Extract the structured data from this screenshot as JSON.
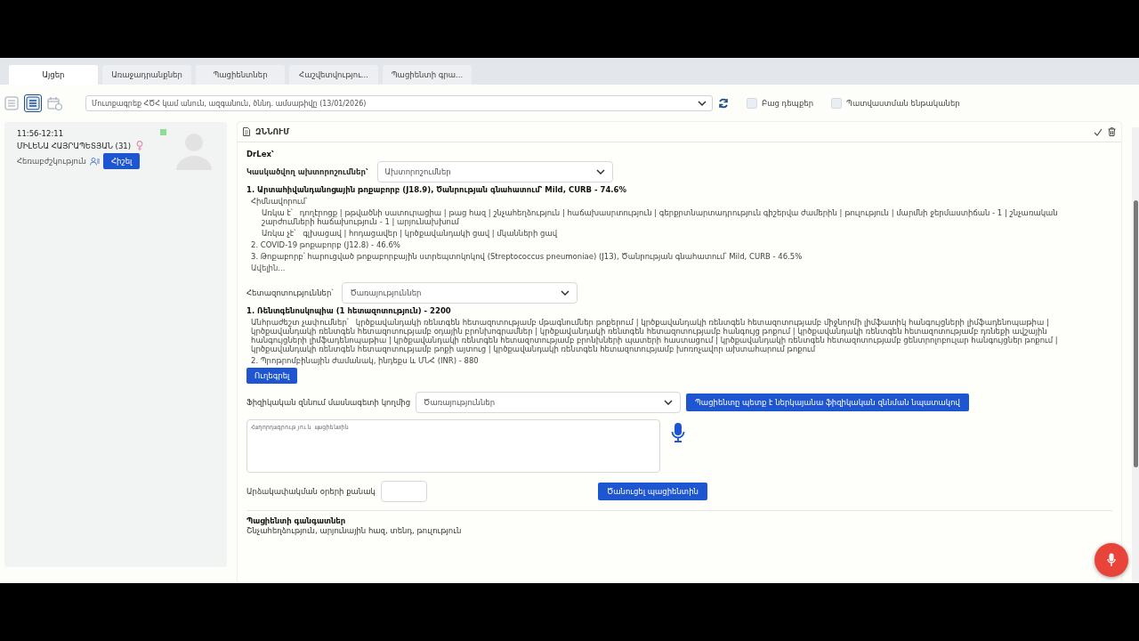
{
  "tabs": [
    {
      "label": "Այցեր",
      "selected": true
    },
    {
      "label": "Առաջադրանքներ",
      "selected": false
    },
    {
      "label": "Պացիենտներ",
      "selected": false
    },
    {
      "label": "Հաշվետվությու...",
      "selected": false
    },
    {
      "label": "Պացիենտի գրա...",
      "selected": false
    }
  ],
  "toolbar": {
    "views": [
      {
        "kind": "list",
        "selected": false
      },
      {
        "kind": "detail",
        "selected": true
      },
      {
        "kind": "calendar",
        "selected": false
      }
    ],
    "search": {
      "placeholder": "Մուտքագրեք ՀԾՀ կամ անուն, ազգանուն, ծննդ. ամսաթիվը (13/01/2026)"
    },
    "filters": [
      {
        "label": "Բաց դեպքեր",
        "checked": false
      },
      {
        "label": "Պատվաստման ենթականեր",
        "checked": false
      }
    ]
  },
  "visit": {
    "time": "11:56-12:11",
    "patient": "ՄԻԼԵՆԱ ՀԱՅՐԱՊԵՏՅԱՆ (31)",
    "type": "Հեռաբժշկություն",
    "button": "Հիշել"
  },
  "exam": {
    "title": "ԶՆՆՈՒՄ",
    "source": "DrLex՝",
    "diagnoses_label": "Կասկածվող ախտորոշումներ՝",
    "diagnoses_select": "Ախտորոշումներ",
    "diagnoses": [
      {
        "title": "1. Արտահիվանդանոցային թոքաբորբ (J18.9), Ծանրության գնահատում՝ Mild, CURB - 74.6%",
        "expanded": true,
        "rationale_label": "Հիմնավորում՝",
        "present_label": "Առկա է՝",
        "present": "դողէրոցք | թթվածնի սատուրացիա | թաց հազ | շնչահեղձություն | հաճախասրտություն | գերքրտնարտադրություն գիշերվա ժամերին | թուլություն | մարմնի ջերմաստիճան - 1 | շնչառական շարժումների հաճախություն - 1 | արյունախխում",
        "absent_label": "Առկա չէ՝",
        "absent": "գլխացավ | հոդացավեր | կրծքավանդակի ցավ | մկանների ցավ"
      },
      {
        "title": "2. COVID-19 թոքաբորբ (J12.8) - 46.6%",
        "expanded": false
      },
      {
        "title": "3. Թոքաբորբ՝ հարուցված թոքաբորբային ստրեպտոկոկով (Streptococcus pneumoniae) (J13), Ծանրության գնահատում՝ Mild, CURB - 46.5%",
        "expanded": false
      }
    ],
    "more_link": "Ավելին...",
    "tests_label": "Հետազոտություններ՝",
    "tests_select": "Ծառայություններ",
    "tests": [
      {
        "title": "1. Ռենտգենոսկոպիա (1 հետազոտություն) - 2200",
        "expanded": true,
        "details_label": "Անհրաժեշտ չափումներ՝",
        "details": "կրծքավանդակի ռենտգեն հետազոտությամբ մթագնումներ թոքերում | կրծքավանդակի ռենտգեն հետազոտությամբ միջնորմի լիմֆատիկ հանգույցների լիմֆադենոպաթիա | կրծքավանդակի ռենտգեն հետազոտությամբ օդային բրոնխոգրամներ | կրծքավանդակի ռենտգեն հետազոտությամբ հանգույց թոքում | կրծքավանդակի ռենտգեն հետազոտությամբ դռնեքի ավշային հանգույցների լիմֆադենոպաթիա | կրծքավանդակի ռենտգեն հետազոտությամբ բրոնխների պատերի հաստացում | կրծքավանդակի ռենտգեն հետազոտությամբ ցենտրոլոբուլար հանգույցներ թոքում | կրծքավանդակի ռենտգեն հետազոտությամբ թոքի այտուց | կրծքավանդակի ռենտգեն հետազոտությամբ խոռոչավոր ախտահարում թոքում"
      },
      {
        "title": "2. Պրոթրոմբինային ժամանակ, ինդեքս և ՄՆՀ (INR) - 880",
        "expanded": false
      }
    ],
    "refer_button": "Ուղեգրել",
    "physical": {
      "label": "Ֆիզիկական զննում մասնագետի կողմից",
      "select": "Ծառայություններ",
      "button": "Պացիենտը պետք է ներկայանա ֆիզիկական զննման նպատակով"
    },
    "message": {
      "placeholder": "Հաղորդագրություն պացիենտին"
    },
    "sick_leave": {
      "label": "Արձակափակման օրերի քանակ"
    },
    "notify_button": "Ծանուցել պացիենտին",
    "complaints": {
      "title": "Պացիենտի գանգատներ",
      "text": "Շնչահեղձություն, արյունային հազ, տենդ, թուլություն"
    }
  }
}
